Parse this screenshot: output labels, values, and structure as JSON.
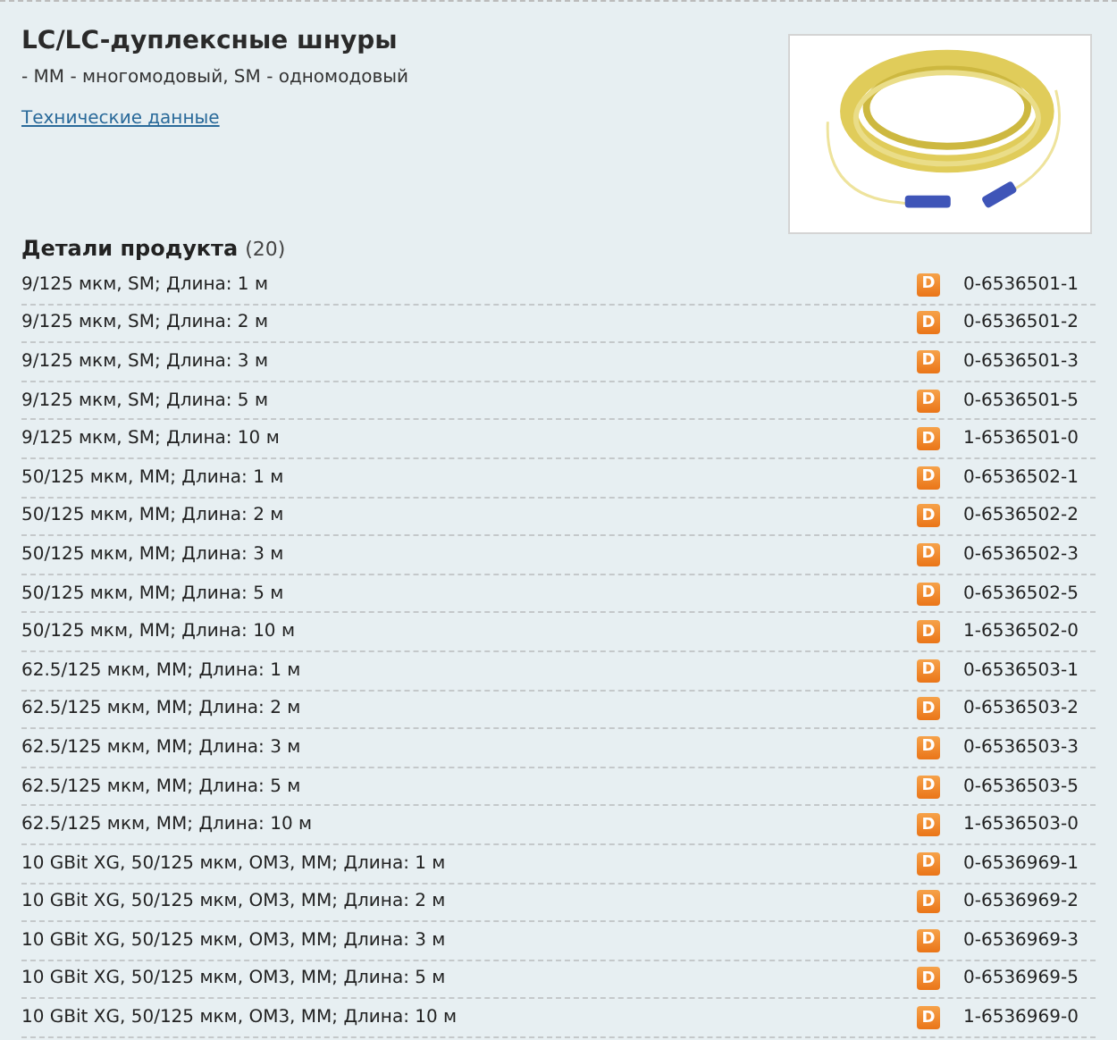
{
  "header": {
    "title": "LC/LC-дуплексные шнуры",
    "subtitle": "- MM - многомодовый, SM - одномодовый",
    "link": "Технические данные"
  },
  "details": {
    "heading": "Детали продукта",
    "count": "(20)",
    "rows": [
      {
        "description": "9/125 мкм, SM; Длина: 1 м",
        "badge": "D",
        "part_number": "0-6536501-1"
      },
      {
        "description": "9/125 мкм, SM; Длина: 2 м",
        "badge": "D",
        "part_number": "0-6536501-2"
      },
      {
        "description": "9/125 мкм, SM; Длина: 3 м",
        "badge": "D",
        "part_number": "0-6536501-3"
      },
      {
        "description": "9/125 мкм, SM; Длина: 5 м",
        "badge": "D",
        "part_number": "0-6536501-5"
      },
      {
        "description": "9/125 мкм, SM; Длина: 10 м",
        "badge": "D",
        "part_number": "1-6536501-0"
      },
      {
        "description": "50/125 мкм, MM; Длина: 1 м",
        "badge": "D",
        "part_number": "0-6536502-1"
      },
      {
        "description": "50/125 мкм, MM; Длина: 2 м",
        "badge": "D",
        "part_number": "0-6536502-2"
      },
      {
        "description": "50/125 мкм, MM; Длина: 3 м",
        "badge": "D",
        "part_number": "0-6536502-3"
      },
      {
        "description": "50/125 мкм, MM; Длина: 5 м",
        "badge": "D",
        "part_number": "0-6536502-5"
      },
      {
        "description": "50/125 мкм, MM; Длина: 10 м",
        "badge": "D",
        "part_number": "1-6536502-0"
      },
      {
        "description": "62.5/125 мкм, MM; Длина: 1 м",
        "badge": "D",
        "part_number": "0-6536503-1"
      },
      {
        "description": "62.5/125 мкм, MM; Длина: 2 м",
        "badge": "D",
        "part_number": "0-6536503-2"
      },
      {
        "description": "62.5/125 мкм, MM; Длина: 3 м",
        "badge": "D",
        "part_number": "0-6536503-3"
      },
      {
        "description": "62.5/125 мкм, MM; Длина: 5 м",
        "badge": "D",
        "part_number": "0-6536503-5"
      },
      {
        "description": "62.5/125 мкм, MM; Длина: 10 м",
        "badge": "D",
        "part_number": "1-6536503-0"
      },
      {
        "description": "10 GBit XG, 50/125 мкм, OM3, MM; Длина: 1 м",
        "badge": "D",
        "part_number": "0-6536969-1"
      },
      {
        "description": "10 GBit XG, 50/125 мкм, OM3, MM; Длина: 2 м",
        "badge": "D",
        "part_number": "0-6536969-2"
      },
      {
        "description": "10 GBit XG, 50/125 мкм, OM3, MM; Длина: 3 м",
        "badge": "D",
        "part_number": "0-6536969-3"
      },
      {
        "description": "10 GBit XG, 50/125 мкм, OM3, MM; Длина: 5 м",
        "badge": "D",
        "part_number": "0-6536969-5"
      },
      {
        "description": "10 GBit XG, 50/125 мкм, OM3, MM; Длина: 10 м",
        "badge": "D",
        "part_number": "1-6536969-0"
      }
    ]
  }
}
